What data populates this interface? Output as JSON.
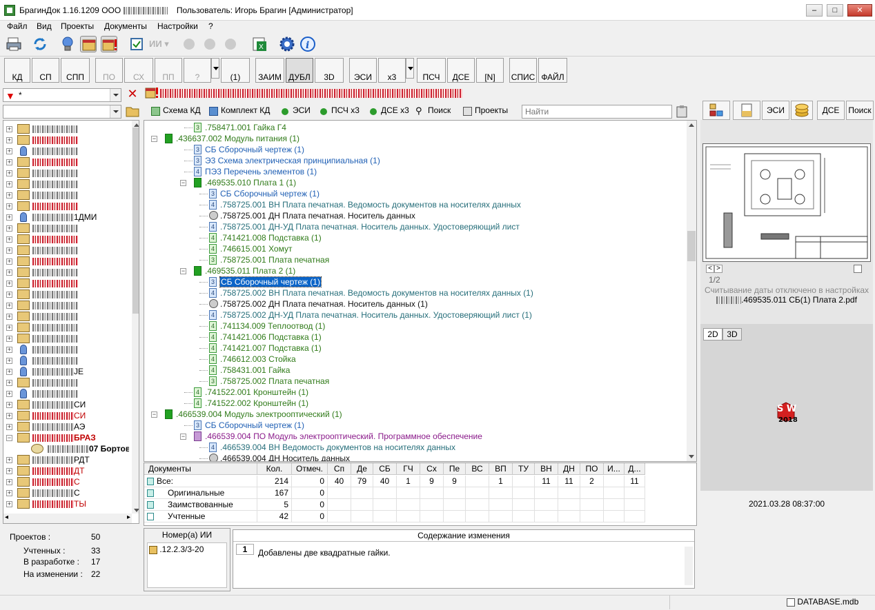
{
  "window": {
    "title_app": "БрагинДок 1.16.1209",
    "title_org": "ООО",
    "title_user": "Пользователь: Игорь Брагин  [Администратор]",
    "btn_minimize": "–",
    "btn_maximize": "□",
    "btn_close": "✕"
  },
  "menu": [
    "Файл",
    "Вид",
    "Проекты",
    "Документы",
    "Настройки",
    "?"
  ],
  "toolbar1": [
    {
      "name": "print-icon"
    },
    {
      "name": "refresh-icon"
    },
    {
      "name": "bulb-icon"
    },
    {
      "name": "archive-icon"
    },
    {
      "name": "archive-alert-icon"
    },
    {
      "name": "checkbox-icon"
    },
    {
      "name": "ii-icon",
      "label": "ИИ"
    },
    {
      "name": "gear-group-icon"
    },
    {
      "name": "excel-export-icon"
    },
    {
      "name": "settings-gear-icon"
    },
    {
      "name": "info-icon"
    }
  ],
  "toolbar2": [
    {
      "label": "КД",
      "state": "enabled"
    },
    {
      "label": "СП",
      "state": "enabled"
    },
    {
      "label": "СПП",
      "state": "enabled"
    },
    {
      "label": "ПО",
      "state": "disabled"
    },
    {
      "label": "СХ",
      "state": "disabled"
    },
    {
      "label": "ПП",
      "state": "disabled"
    },
    {
      "label": "?",
      "state": "disabled"
    },
    {
      "label": "(1)",
      "state": "enabled"
    },
    {
      "label": "ЗАИМ",
      "state": "enabled"
    },
    {
      "label": "ДУБЛ",
      "state": "pressed"
    },
    {
      "label": "3D",
      "state": "enabled"
    },
    {
      "label": "ЭСИ",
      "state": "enabled"
    },
    {
      "label": "х3",
      "state": "enabled"
    },
    {
      "label": "ПСЧ",
      "state": "enabled"
    },
    {
      "label": "ДСЕ",
      "state": "enabled"
    },
    {
      "label": "[N]",
      "state": "enabled"
    },
    {
      "label": "СПИС",
      "state": "enabled"
    },
    {
      "label": "ФАЙЛ",
      "state": "enabled"
    }
  ],
  "filter": {
    "value": "*"
  },
  "tabs": [
    {
      "label": "Схема КД",
      "icon": "scheme-icon"
    },
    {
      "label": "Комплект КД",
      "icon": "set-icon"
    },
    {
      "label": "ЭСИ",
      "icon": "green-dot-icon"
    },
    {
      "label": "ПСЧ х3",
      "icon": "green-dot-icon"
    },
    {
      "label": "ДСЕ х3",
      "icon": "green-dot-icon"
    },
    {
      "label": "Поиск",
      "icon": "binoculars-icon"
    },
    {
      "label": "Проекты",
      "icon": "chart-icon"
    }
  ],
  "find": {
    "placeholder": "Найти"
  },
  "left_tree": [
    {
      "text": "",
      "style": ""
    },
    {
      "text": "",
      "style": "red"
    },
    {
      "text": "",
      "style": ""
    },
    {
      "text": "",
      "style": "red"
    },
    {
      "text": "",
      "style": ""
    },
    {
      "text": "",
      "style": ""
    },
    {
      "text": "",
      "style": ""
    },
    {
      "text": "",
      "style": "red"
    },
    {
      "text": "1ДМИ",
      "style": ""
    },
    {
      "text": "",
      "style": ""
    },
    {
      "text": "",
      "style": "red"
    },
    {
      "text": "",
      "style": ""
    },
    {
      "text": "",
      "style": "red"
    },
    {
      "text": "",
      "style": ""
    },
    {
      "text": "",
      "style": "red"
    },
    {
      "text": "",
      "style": ""
    },
    {
      "text": "",
      "style": ""
    },
    {
      "text": "",
      "style": ""
    },
    {
      "text": "",
      "style": ""
    },
    {
      "text": "",
      "style": ""
    },
    {
      "text": "",
      "style": ""
    },
    {
      "text": "",
      "style": ""
    },
    {
      "text": "JE",
      "style": ""
    },
    {
      "text": "",
      "style": ""
    },
    {
      "text": "",
      "style": ""
    },
    {
      "text": "СИ",
      "style": ""
    },
    {
      "text": "СИ",
      "style": "red"
    },
    {
      "text": "АЭ",
      "style": ""
    },
    {
      "text": "БРАЗ",
      "style": "red bold"
    },
    {
      "text": "07 Бортов",
      "style": "bold"
    },
    {
      "text": "РДТ",
      "style": ""
    },
    {
      "text": "ДТ",
      "style": "red"
    },
    {
      "text": "С",
      "style": "red"
    },
    {
      "text": "С",
      "style": ""
    },
    {
      "text": "ТЫ",
      "style": "red"
    }
  ],
  "stats": {
    "projects_label": "Проектов :",
    "projects": "50",
    "counted_label": "Учтенных :",
    "counted": "33",
    "dev_label": "В разработке :",
    "dev": "17",
    "change_label": "На изменении :",
    "change": "22"
  },
  "tree": [
    {
      "text": ".758471.001 Гайка Г4",
      "color": "green",
      "icon": "g",
      "num": "3",
      "indent": 3
    },
    {
      "text": ".436637.002 Модуль питания (1)",
      "color": "green",
      "icon": "gg",
      "num": "",
      "indent": 2,
      "box": "-"
    },
    {
      "text": "СБ Сборочный чертеж (1)",
      "color": "blue",
      "icon": "b",
      "num": "3",
      "indent": 3
    },
    {
      "text": "Э3 Схема электрическая принципиальная (1)",
      "color": "blue",
      "icon": "b",
      "num": "3",
      "indent": 3
    },
    {
      "text": "ПЭ3 Перечень элементов (1)",
      "color": "blue",
      "icon": "b",
      "num": "4",
      "indent": 3
    },
    {
      "text": ".469535.010 Плата 1 (1)",
      "color": "green",
      "icon": "gg",
      "num": "",
      "indent": 3,
      "box": "-"
    },
    {
      "text": "СБ Сборочный чертеж (1)",
      "color": "blue",
      "icon": "b",
      "num": "3",
      "indent": 4
    },
    {
      "text": ".758725.001 ВН Плата печатная. Ведомость документов на носителях данных",
      "color": "teal",
      "icon": "b",
      "num": "4",
      "indent": 4
    },
    {
      "text": ".758725.001 ДН Плата печатная. Носитель данных",
      "color": "dark",
      "icon": "circ",
      "num": "",
      "indent": 4
    },
    {
      "text": ".758725.001 ДН-УД Плата печатная. Носитель данных. Удостоверяющий лист",
      "color": "teal",
      "icon": "b",
      "num": "4",
      "indent": 4
    },
    {
      "text": ".741421.008 Подставка (1)",
      "color": "green",
      "icon": "g",
      "num": "4",
      "indent": 4
    },
    {
      "text": ".746615.001 Хомут",
      "color": "green",
      "icon": "g",
      "num": "4",
      "indent": 4
    },
    {
      "text": ".758725.001 Плата печатная",
      "color": "green",
      "icon": "g",
      "num": "3",
      "indent": 4
    },
    {
      "text": ".469535.011 Плата 2 (1)",
      "color": "green",
      "icon": "gg",
      "num": "",
      "indent": 3,
      "box": "-"
    },
    {
      "text": "СБ Сборочный чертеж (1)",
      "color": "blue",
      "icon": "b",
      "num": "3",
      "indent": 4,
      "selected": true
    },
    {
      "text": ".758725.002 ВН Плата печатная. Ведомость документов на носителях данных (1)",
      "color": "teal",
      "icon": "b",
      "num": "4",
      "indent": 4
    },
    {
      "text": ".758725.002 ДН Плата печатная. Носитель данных (1)",
      "color": "dark",
      "icon": "circ",
      "num": "",
      "indent": 4
    },
    {
      "text": ".758725.002 ДН-УД Плата печатная. Носитель данных. Удостоверяющий лист (1)",
      "color": "teal",
      "icon": "b",
      "num": "4",
      "indent": 4
    },
    {
      "text": ".741134.009 Теплоотвод (1)",
      "color": "green",
      "icon": "g",
      "num": "4",
      "indent": 4
    },
    {
      "text": ".741421.006 Подставка (1)",
      "color": "green",
      "icon": "g",
      "num": "4",
      "indent": 4
    },
    {
      "text": ".741421.007 Подставка (1)",
      "color": "green",
      "icon": "g",
      "num": "4",
      "indent": 4
    },
    {
      "text": ".746612.003 Стойка",
      "color": "green",
      "icon": "g",
      "num": "4",
      "indent": 4
    },
    {
      "text": ".758431.001 Гайка",
      "color": "green",
      "icon": "g",
      "num": "4",
      "indent": 4
    },
    {
      "text": ".758725.002 Плата печатная",
      "color": "green",
      "icon": "g",
      "num": "3",
      "indent": 4
    },
    {
      "text": ".741522.001 Кронштейн (1)",
      "color": "green",
      "icon": "g",
      "num": "4",
      "indent": 3
    },
    {
      "text": ".741522.002 Кронштейн (1)",
      "color": "green",
      "icon": "g",
      "num": "4",
      "indent": 3
    },
    {
      "text": ".466539.004 Модуль электрооптический (1)",
      "color": "green",
      "icon": "gg",
      "num": "",
      "indent": 2,
      "box": "-"
    },
    {
      "text": "СБ Сборочный чертеж (1)",
      "color": "blue",
      "icon": "b",
      "num": "3",
      "indent": 3
    },
    {
      "text": ".466539.004 ПО Модуль электрооптический. Программное обеспечение",
      "color": "purple",
      "icon": "purple",
      "num": "",
      "indent": 3,
      "box": "-"
    },
    {
      "text": ".466539.004 ВН Ведомость документов на носителях данных",
      "color": "teal",
      "icon": "b",
      "num": "4",
      "indent": 4
    },
    {
      "text": ".466539.004 ДН Носитель данных",
      "color": "dark",
      "icon": "circ",
      "num": "",
      "indent": 4
    }
  ],
  "doctable": {
    "headers": [
      "Документы",
      "Кол.",
      "Отмеч.",
      "Сп",
      "Де",
      "СБ",
      "ГЧ",
      "Сх",
      "Пе",
      "ВС",
      "ВП",
      "ТУ",
      "ВН",
      "ДН",
      "ПО",
      "И...",
      "Д..."
    ],
    "rows": [
      {
        "label": "Все:",
        "vals": [
          "214",
          "0",
          "40",
          "79",
          "40",
          "1",
          "9",
          "9",
          "",
          "1",
          "",
          "11",
          "11",
          "2",
          "",
          "11"
        ]
      },
      {
        "label": "Оригинальные",
        "vals": [
          "167",
          "0",
          "",
          "",
          "",
          "",
          "",
          "",
          "",
          "",
          "",
          "",
          "",
          "",
          "",
          ""
        ]
      },
      {
        "label": "Заимствованные",
        "vals": [
          "5",
          "0",
          "",
          "",
          "",
          "",
          "",
          "",
          "",
          "",
          "",
          "",
          "",
          "",
          "",
          ""
        ]
      },
      {
        "label": "Учтенные",
        "vals": [
          "42",
          "0",
          "",
          "",
          "",
          "",
          "",
          "",
          "",
          "",
          "",
          "",
          "",
          "",
          "",
          ""
        ]
      }
    ]
  },
  "ii": {
    "header": "Номер(а) ИИ",
    "item": ".12.2.3/3-20"
  },
  "changes": {
    "header": "Содержание изменения",
    "num": "1",
    "text": "Добавлены две квадратные гайки."
  },
  "right_tabs": [
    {
      "label": "",
      "icon": "tree-icon"
    },
    {
      "label": "",
      "icon": "doc-icon"
    },
    {
      "label": "ЭСИ",
      "icon": ""
    },
    {
      "label": "",
      "icon": "coins-icon"
    },
    {
      "label": "ДСЕ",
      "icon": ""
    },
    {
      "label": "Поиск",
      "icon": ""
    }
  ],
  "preview": {
    "page": "1/2",
    "note": "Считывание даты отключено в настройках",
    "file": ".469535.011 СБ(1) Плата 2.pdf",
    "btn_prev": "<",
    "btn_next": ">"
  },
  "viewer": {
    "btn2d": "2D",
    "btn3d": "3D",
    "sw_label": "S W",
    "sw_year": "2018",
    "timestamp": "2021.03.28  08:37:00"
  },
  "status": {
    "db": "DATABASE.mdb"
  }
}
